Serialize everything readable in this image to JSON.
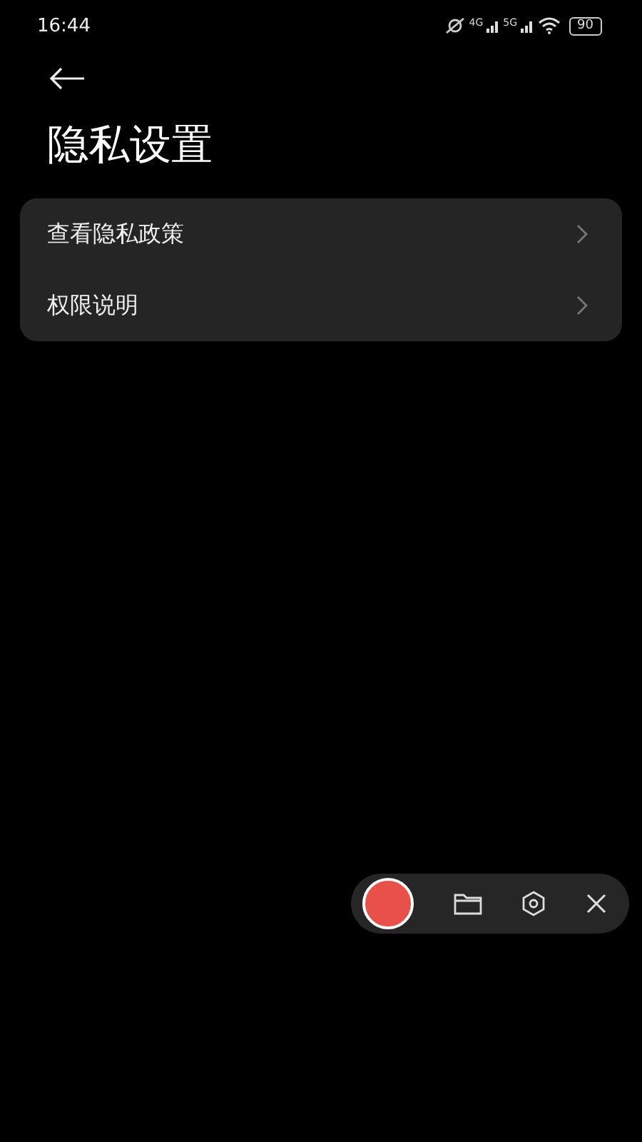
{
  "status_bar": {
    "time": "16:44",
    "network_1": "4G",
    "network_2": "5G",
    "battery": "90"
  },
  "title": "隐私设置",
  "menu_items": [
    {
      "label": "查看隐私政策"
    },
    {
      "label": "权限说明"
    }
  ],
  "recorder": {
    "recording": false
  }
}
